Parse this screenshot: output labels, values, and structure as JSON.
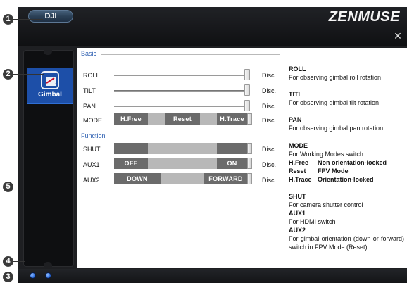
{
  "window": {
    "brand_label": "DJI",
    "product_title": "ZENMUSE",
    "minimize_glyph": "–",
    "close_glyph": "✕"
  },
  "callouts": [
    "1",
    "2",
    "3",
    "4",
    "5"
  ],
  "sidebar": {
    "items": [
      {
        "label": "Gimbal",
        "icon": "gimbal-icon",
        "selected": true
      }
    ]
  },
  "status_leds": {
    "count": 2,
    "color": "#2d6fe0"
  },
  "basic": {
    "section_title": "Basic",
    "rows": [
      {
        "label": "ROLL",
        "state": "Disc.",
        "slider_level": 1.0
      },
      {
        "label": "TILT",
        "state": "Disc.",
        "slider_level": 1.0
      },
      {
        "label": "PAN",
        "state": "Disc.",
        "slider_level": 1.0
      }
    ],
    "mode": {
      "label": "MODE",
      "options": [
        "H.Free",
        "Reset",
        "H.Trace"
      ],
      "state": "Disc."
    }
  },
  "function": {
    "section_title": "Function",
    "shut": {
      "label": "SHUT",
      "state": "Disc."
    },
    "aux1": {
      "label": "AUX1",
      "off_label": "OFF",
      "on_label": "ON",
      "state": "Disc."
    },
    "aux2": {
      "label": "AUX2",
      "down_label": "DOWN",
      "forward_label": "FORWARD",
      "state": "Disc."
    }
  },
  "help": {
    "roll": {
      "title": "ROLL",
      "text": "For observing gimbal roll rotation"
    },
    "tilt": {
      "title": "TITL",
      "text": "For observing gimbal tilt rotation"
    },
    "pan": {
      "title": "PAN",
      "text": "For observing gimbal pan rotation"
    },
    "mode": {
      "title": "MODE",
      "text": "For Working Modes switch",
      "entries": [
        {
          "key": "H.Free",
          "value": "Non orientation-locked"
        },
        {
          "key": "Reset",
          "value": "FPV Mode"
        },
        {
          "key": "H.Trace",
          "value": "Orientation-locked"
        }
      ]
    },
    "shut": {
      "title": "SHUT",
      "text": "For camera shutter control"
    },
    "aux1": {
      "title": "AUX1",
      "text": "For HDMI switch"
    },
    "aux2": {
      "title": "AUX2",
      "text": "For gimbal orientation (down or forward) switch in FPV Mode (Reset)"
    }
  },
  "colors": {
    "accent_blue": "#1d4fa8",
    "section_title_blue": "#2a5db0",
    "segment_dark": "#6b6b6b",
    "segment_light": "#b8b8b8"
  }
}
